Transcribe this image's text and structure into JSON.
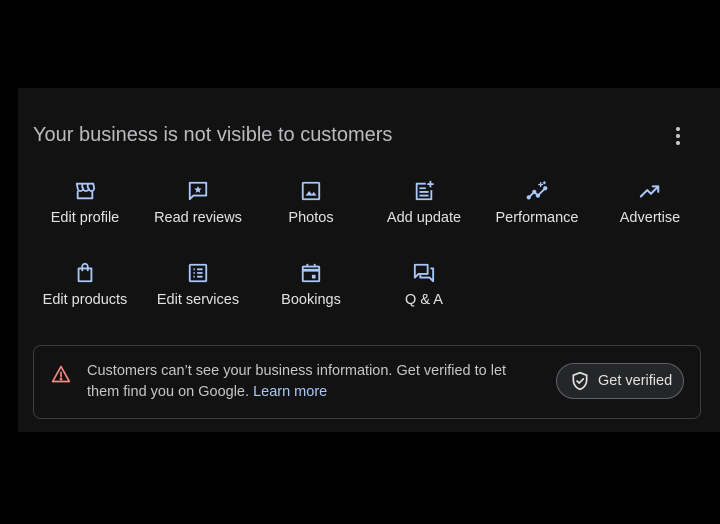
{
  "card": {
    "title": "Your business is not visible to customers",
    "more_icon": "more-vert-icon"
  },
  "actions": [
    {
      "label": "Edit profile",
      "icon": "storefront-icon"
    },
    {
      "label": "Read reviews",
      "icon": "review-star-icon"
    },
    {
      "label": "Photos",
      "icon": "photo-icon"
    },
    {
      "label": "Add update",
      "icon": "post-add-icon"
    },
    {
      "label": "Performance",
      "icon": "insights-icon"
    },
    {
      "label": "Advertise",
      "icon": "trending-up-icon"
    },
    {
      "label": "Edit products",
      "icon": "shopping-bag-icon"
    },
    {
      "label": "Edit services",
      "icon": "list-icon"
    },
    {
      "label": "Bookings",
      "icon": "calendar-icon"
    },
    {
      "label": "Q & A",
      "icon": "forum-icon"
    }
  ],
  "notice": {
    "text": "Customers can’t see your business information. Get verified to let them find you on Google. ",
    "link": "Learn more",
    "button_label": "Get verified",
    "warning_color": "#f28b82"
  },
  "colors": {
    "background": "#000000",
    "card": "#121212",
    "icon": "#a8c7fa",
    "text": "#e3e3e3"
  }
}
